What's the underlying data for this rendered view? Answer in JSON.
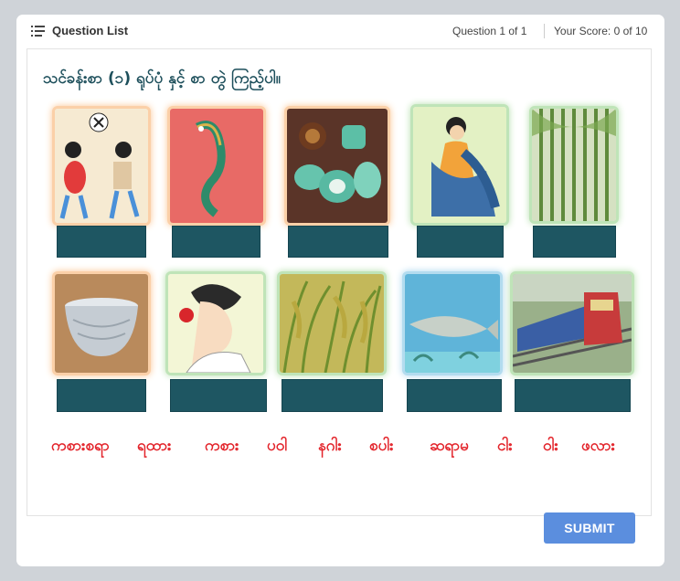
{
  "header": {
    "question_list_label": "Question List",
    "question_counter": "Question 1 of 1",
    "score": "Your Score: 0 of 10",
    "icon": "list-icon"
  },
  "question": {
    "instruction": "သင်ခန်းစာ (၁) ရုပ်ပုံ နှင့် စာ တွဲ ကြည့်ပါ။"
  },
  "images": [
    {
      "name": "children-playing-ball",
      "glow": "orange"
    },
    {
      "name": "dragon-statue",
      "glow": "orange"
    },
    {
      "name": "tea-set",
      "glow": "orange"
    },
    {
      "name": "woman-with-scarf",
      "glow": "green"
    },
    {
      "name": "bamboo",
      "glow": "green"
    },
    {
      "name": "silver-bowl",
      "glow": "orange"
    },
    {
      "name": "woman-flower-hair",
      "glow": "green"
    },
    {
      "name": "rice-plants",
      "glow": "green"
    },
    {
      "name": "fish-aquarium",
      "glow": "blue"
    },
    {
      "name": "train",
      "glow": "green"
    }
  ],
  "words": [
    "ကစားစရာ",
    "ရထား",
    "ကစား",
    "ပဝါ",
    "နဂါး",
    "စပါး",
    "ဆရာမ",
    "ငါး",
    "ဝါး",
    "ဖလား"
  ],
  "submit_label": "SUBMIT",
  "colors": {
    "slot": "#1e5662",
    "word": "#e3242b",
    "submit": "#5b8ede",
    "instruction": "#1d4f5b"
  }
}
